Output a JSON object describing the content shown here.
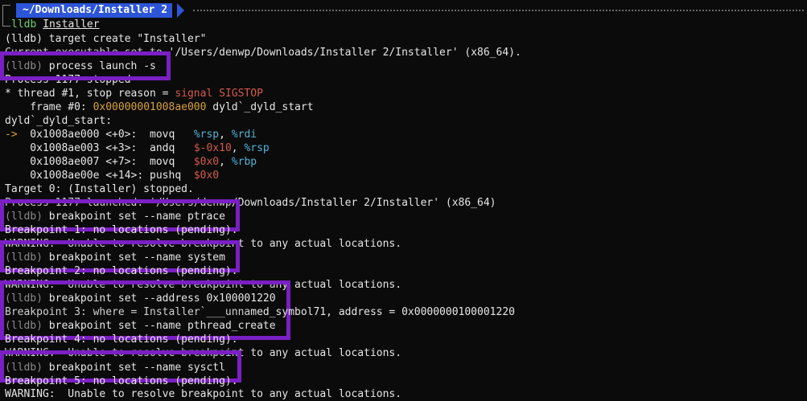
{
  "header": {
    "path_prefix": "~/Downloads/",
    "path_bold": "Installer 2",
    "command": "lldb",
    "command_arg": "Installer"
  },
  "lines": {
    "l1": "(lldb) target create \"Installer\"",
    "l2_hidden": "Current executable set to ",
    "l2_visible": "'/Users/denwp/Downloads/Installer 2/Installer' (x86_64).",
    "l3_prompt": "(lldb)",
    "l3_cmd": " process launch -s",
    "l4_hidden": "Process 1177 stopped",
    "l5": "* thread #1, stop reason = ",
    "l5_red": "signal SIGSTOP",
    "l6_a": "    frame #0: ",
    "l6_addr": "0x00000001008ae000",
    "l6_b": " dyld`_dyld_start",
    "l7": "dyld`_dyld_start:",
    "asm": [
      {
        "arrow": "->",
        "addr": "  0x1008ae000 <+0>:  ",
        "op": "movq   ",
        "a1": "%rsp",
        "sep": ", ",
        "a2": "%rdi",
        "a1c": "cyan",
        "a2c": "cyan"
      },
      {
        "arrow": "  ",
        "addr": "  0x1008ae003 <+3>:  ",
        "op": "andq   ",
        "a1": "$-0x10",
        "sep": ", ",
        "a2": "%rsp",
        "a1c": "red",
        "a2c": "cyan"
      },
      {
        "arrow": "  ",
        "addr": "  0x1008ae007 <+7>:  ",
        "op": "movq   ",
        "a1": "$0x0",
        "sep": ", ",
        "a2": "%rbp",
        "a1c": "red",
        "a2c": "cyan"
      },
      {
        "arrow": "  ",
        "addr": "  0x1008ae00e <+14>: ",
        "op": "pushq  ",
        "a1": "$0x0",
        "sep": "",
        "a2": "",
        "a1c": "red",
        "a2c": "cyan"
      }
    ],
    "l12": "Target 0: (Installer) stopped.",
    "l13_hidden": "Process 1177 launched: '/Users/denwp",
    "l13_visible": "/Downloads/Installer 2/Installer' (x86_64)",
    "bp1_prompt": "(lldb)",
    "bp1_cmd": " breakpoint set --name ptrace",
    "bp1_res_hidden": "Breakpoint 1: no locations (pending).",
    "warn1_hidden": "WARNING:  Unable to resolve breakpoi",
    "warn1_visible": "nt to any actual locations.",
    "bp2_prompt": "(lldb)",
    "bp2_cmd": " breakpoint set --name system",
    "bp2_res_hidden": "Breakpoint 2: no locations (pending).",
    "warn2_hidden": "WARNING:  Unable to resolve breakpoint to a",
    "warn2_visible": "ny actual locations.",
    "bp3_prompt": "(lldb)",
    "bp3_cmd": " breakpoint set --address 0x100001220",
    "bp3_res_hidden": "Breakpoint 3: where = Installer`___unna",
    "bp3_res_visible": "med_symbol71, address = 0x0000000100001220",
    "bp4_prompt": "(lldb)",
    "bp4_cmd": " breakpoint set --name pthread_create",
    "bp4_res_hidden": "Breakpoint 4: no locations (pending).",
    "warn4_hidden": "WARNING:  Unable to resolve breakpoi",
    "warn4_visible": "nt to any actual locations.",
    "bp5_prompt": "(lldb)",
    "bp5_cmd": " breakpoint set --name sysctl",
    "bp5_res_hidden": "Breakpoint 5: no locations (pending).",
    "warn5": "WARNING:  Unable to resolve breakpoint to any actual locations."
  },
  "colors": {
    "highlight_box": "#7a1fc4",
    "path_pill": "#2c55d8",
    "register": "#4fb3d6",
    "immediate": "#d55a4a",
    "address": "#d8a03a"
  }
}
